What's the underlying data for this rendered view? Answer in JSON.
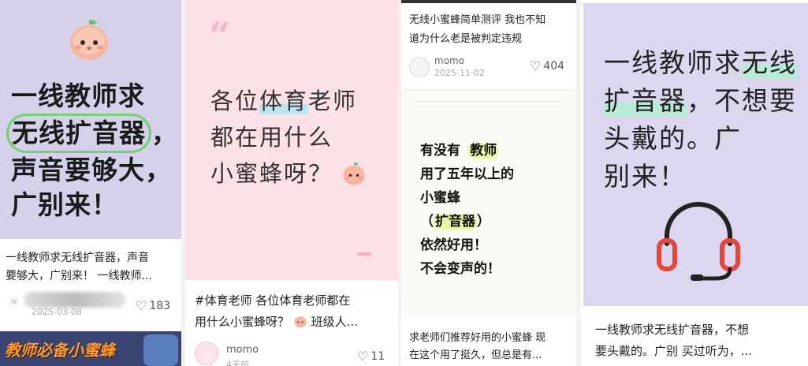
{
  "cards": [
    {
      "cover": {
        "lines": [
          "一线教师求",
          "无线扩音器",
          "，",
          "声音要够大，",
          "广别来！"
        ],
        "bg": "#d7d0ea"
      },
      "desc_lines": [
        "一线教师求无线扩音器，声音",
        "要够大，广别来！ 一线教师..."
      ],
      "date": "2025-03-08",
      "likes": "183",
      "banner": "教师必备小蜜蜂"
    },
    {
      "cover": {
        "quote": "“",
        "line1_a": "各位",
        "line1_b": "体育",
        "line1_c": "老师",
        "line2": "都在用什么",
        "line3": "小蜜蜂呀？",
        "bg": "#fbe0e6"
      },
      "desc_lines": [
        "#体育老师 各位体育老师都在",
        "用什么小蜜蜂呀？",
        "班级人..."
      ],
      "username": "momo",
      "time": "4天前",
      "likes": "11"
    },
    {
      "top_desc_lines": [
        "无线小蜜蜂简单测评 我也不知",
        "道为什么老是被判定违规"
      ],
      "username": "momo",
      "date": "2025-11-02",
      "likes": "404",
      "cover": {
        "line1_a": "有没有 ",
        "line1_b": "教师",
        "line2": "用了五年以上的",
        "line3": "小蜜蜂",
        "line4_a": "（",
        "line4_b": "扩音器",
        "line4_c": "）",
        "line5": "依然好用！",
        "line6": "不会变声的！"
      },
      "desc_lines": [
        "求老师们推荐好用的小蜜蜂 现",
        "在这个用了挺久，但总是有..."
      ]
    },
    {
      "cover": {
        "line1_a": "一线教师求",
        "line1_b": "无线",
        "line2_a": "扩音器",
        "line2_b": "，不想要",
        "line3": "头戴的。广",
        "line4": "别来！",
        "bg": "#dcd6ee"
      },
      "desc_lines": [
        "一线教师求无线扩音器，不想",
        "要头戴的。广别 买过听为，..."
      ]
    }
  ],
  "icons": [
    "peach-mascot-icon",
    "heart-icon",
    "sun-icon",
    "headphones-icon",
    "quote-icon"
  ],
  "colors": {
    "accent_green": "#6fd46b",
    "headphone_red": "#e4473a"
  }
}
